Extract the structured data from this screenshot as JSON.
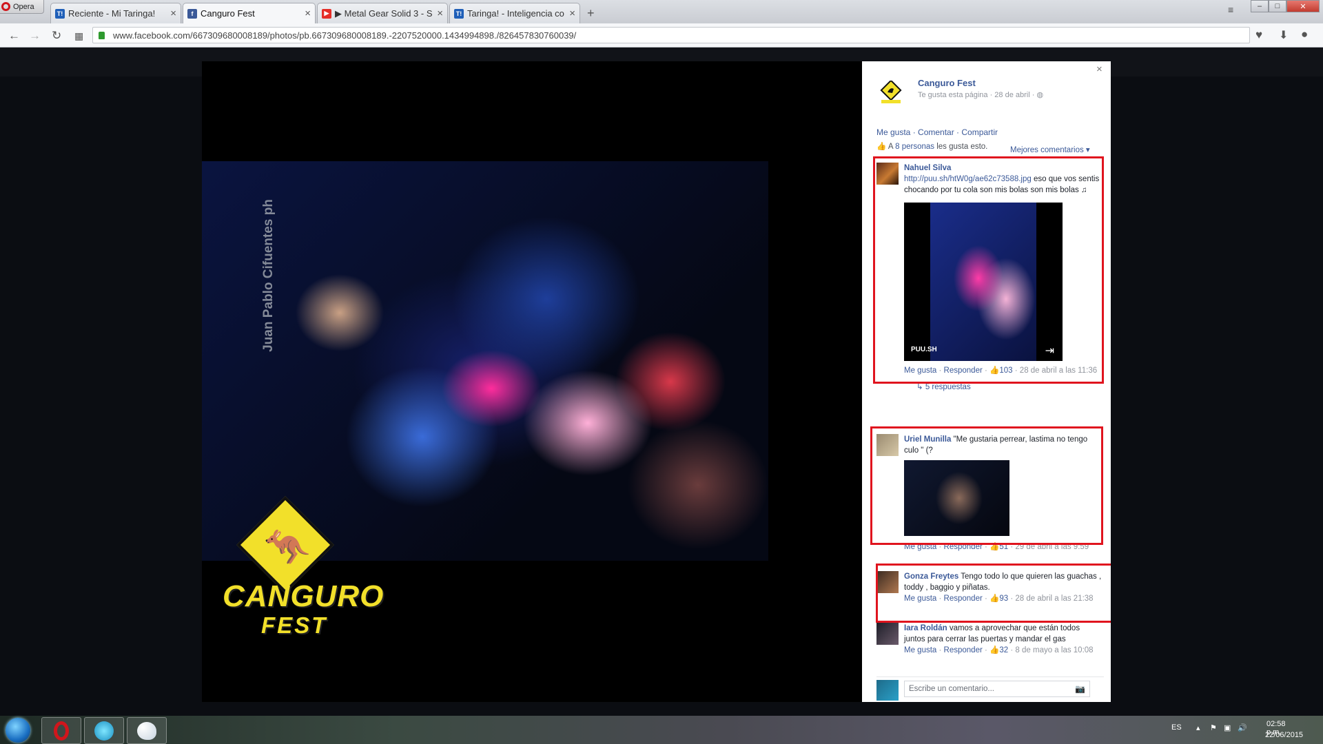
{
  "browser": {
    "menu_label": "Opera",
    "tabs": [
      {
        "favicon": "T!",
        "favicon_color": "#1f5fb8",
        "title": "Reciente - Mi Taringa!"
      },
      {
        "favicon": "f",
        "favicon_color": "#3b5998",
        "title": "Canguro Fest"
      },
      {
        "favicon": "▶",
        "favicon_color": "#e52d27",
        "title": "▶ Metal Gear Solid 3 - S"
      },
      {
        "favicon": "T!",
        "favicon_color": "#1f5fb8",
        "title": "Taringa! - Inteligencia co"
      }
    ],
    "url": "www.facebook.com/667309680008189/photos/pb.667309680008189.-2207520000.1434994898./826457830760039/"
  },
  "photo": {
    "credit": "Juan Pablo Cifuentes ph",
    "logo_line1": "CANGURO",
    "logo_line2": "FEST"
  },
  "panel": {
    "close": "×",
    "page_name": "Canguro Fest",
    "page_sub": "Te gusta esta página · 28 de abril · ",
    "actions": "Me gusta · Comentar · Compartir",
    "likes_prefix": "A ",
    "likes_count": "8 personas",
    "likes_suffix": " les gusta esto.",
    "sort": "Mejores comentarios ▾",
    "comments": [
      {
        "name": "Nahuel Silva",
        "link": "http://puu.sh/htW0g/ae62c73588.jpg",
        "text": " eso que vos sentis chocando por tu cola son mis bolas son mis bolas ♫",
        "attachment_label": "PUU.SH",
        "like_count": "103",
        "date": "28 de abril a las 11:36"
      },
      {
        "name": "Uriel Munilla",
        "text": " \"Me gustaria perrear, lastima no tengo culo \" (?",
        "like_count": "51",
        "date": "29 de abril a las 9:59"
      },
      {
        "name": "Gonza Freytes",
        "text": " Tengo todo lo que quieren las guachas , toddy , baggio y piñatas.",
        "like_count": "93",
        "date": "28 de abril a las 21:38"
      },
      {
        "name": "Iara Roldán",
        "text": " vamos a aprovechar que están todos juntos para cerrar las puertas y mandar el gas",
        "like_count": "32",
        "date": "8 de mayo a las 10:08"
      }
    ],
    "replies": "5 respuestas",
    "me_gusta": "Me gusta",
    "responder": "Responder",
    "composer_placeholder": "Escribe un comentario..."
  },
  "taskbar": {
    "lang": "ES",
    "time": "02:58 p.m.",
    "date": "22/06/2015"
  }
}
